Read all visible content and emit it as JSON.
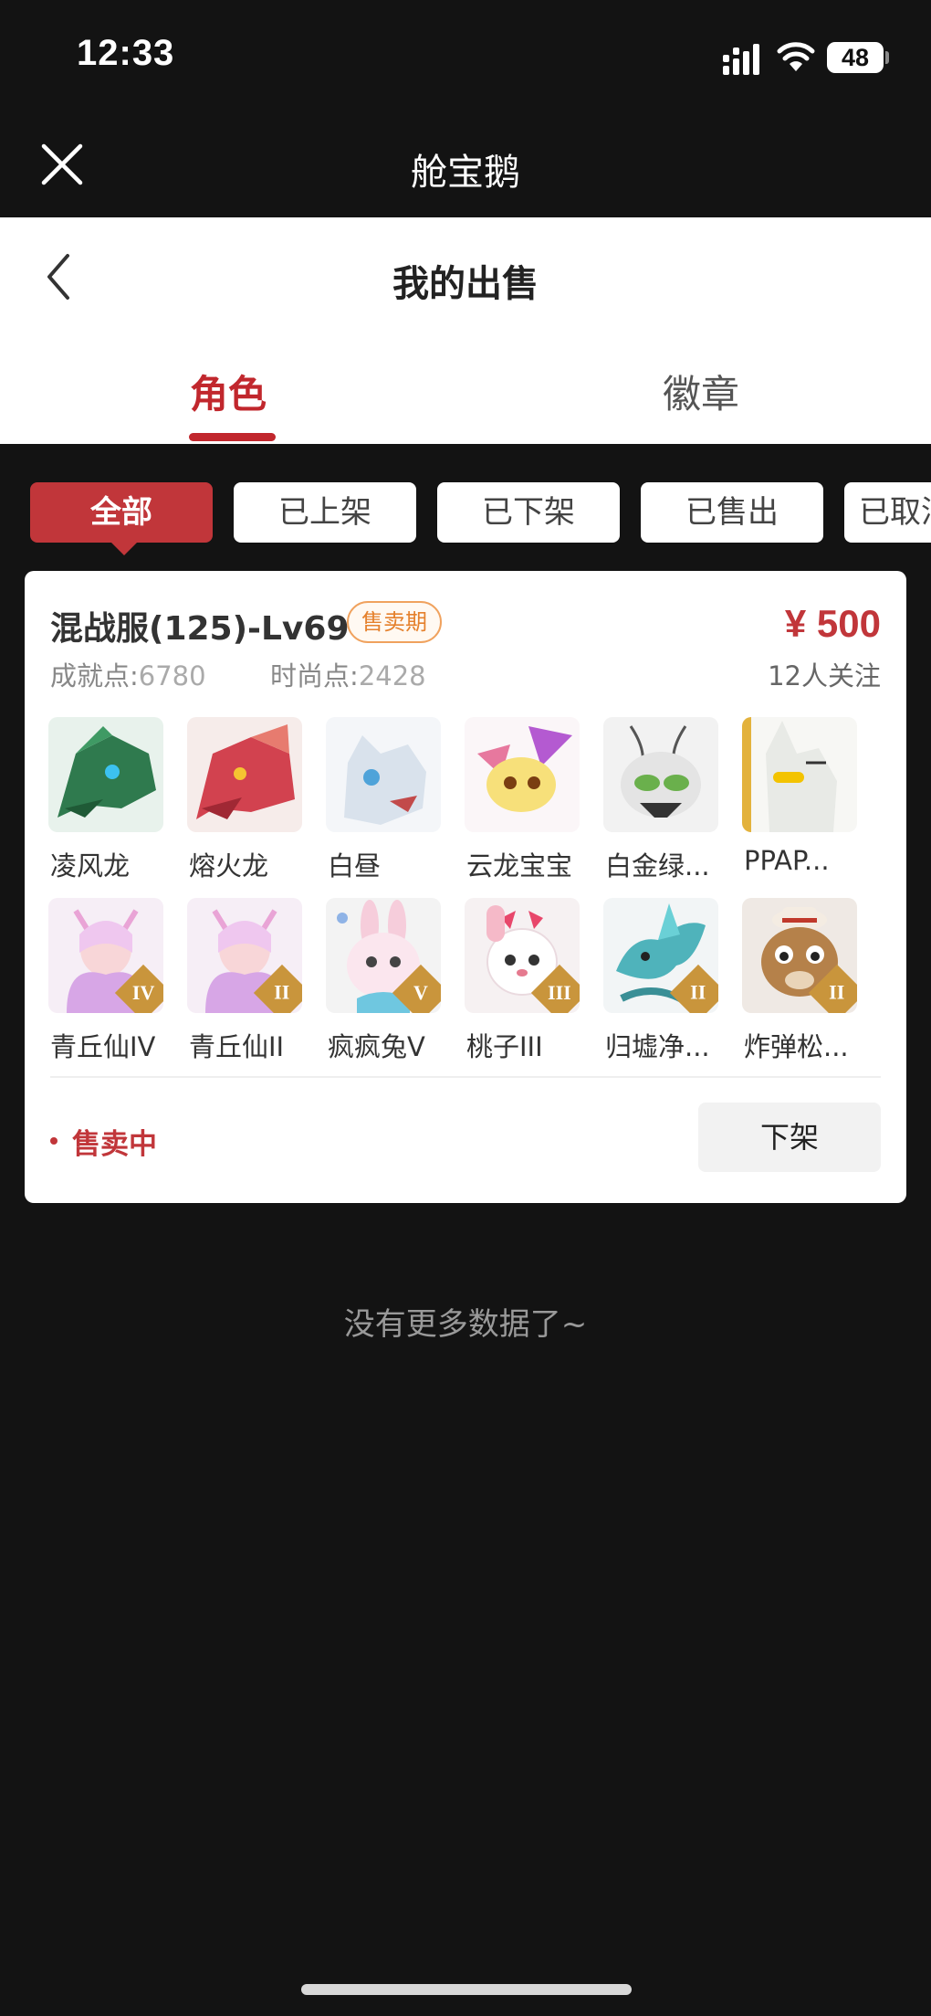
{
  "status_bar": {
    "time": "12:33",
    "battery": "48"
  },
  "titlebar": {
    "title": "舱宝鹅"
  },
  "header": {
    "title": "我的出售"
  },
  "tabs": [
    {
      "label": "角色"
    },
    {
      "label": "徽章"
    }
  ],
  "filters": [
    {
      "label": "全部"
    },
    {
      "label": "已上架"
    },
    {
      "label": "已下架"
    },
    {
      "label": "已售出"
    },
    {
      "label": "已取消"
    }
  ],
  "listing": {
    "server": "混战服(125)-Lv69",
    "badge": "售卖期",
    "price": "¥ 500",
    "achievement_label": "成就点:",
    "achievement_value": "6780",
    "fashion_label": "时尚点:",
    "fashion_value": "2428",
    "followers": "12人关注",
    "pets": [
      {
        "name": "凌风龙",
        "tier": ""
      },
      {
        "name": "熔火龙",
        "tier": ""
      },
      {
        "name": "白昼",
        "tier": ""
      },
      {
        "name": "云龙宝宝",
        "tier": ""
      },
      {
        "name": "白金绿...",
        "tier": ""
      },
      {
        "name": "PPAP...",
        "tier": ""
      },
      {
        "name": "青丘仙IV",
        "tier": "IV"
      },
      {
        "name": "青丘仙II",
        "tier": "II"
      },
      {
        "name": "疯疯兔V",
        "tier": "V"
      },
      {
        "name": "桃子III",
        "tier": "III"
      },
      {
        "name": "归墟净...",
        "tier": "II"
      },
      {
        "name": "炸弹松...",
        "tier": "II"
      }
    ],
    "status": "售卖中",
    "delist_label": "下架"
  },
  "footer": {
    "no_more": "没有更多数据了~"
  }
}
